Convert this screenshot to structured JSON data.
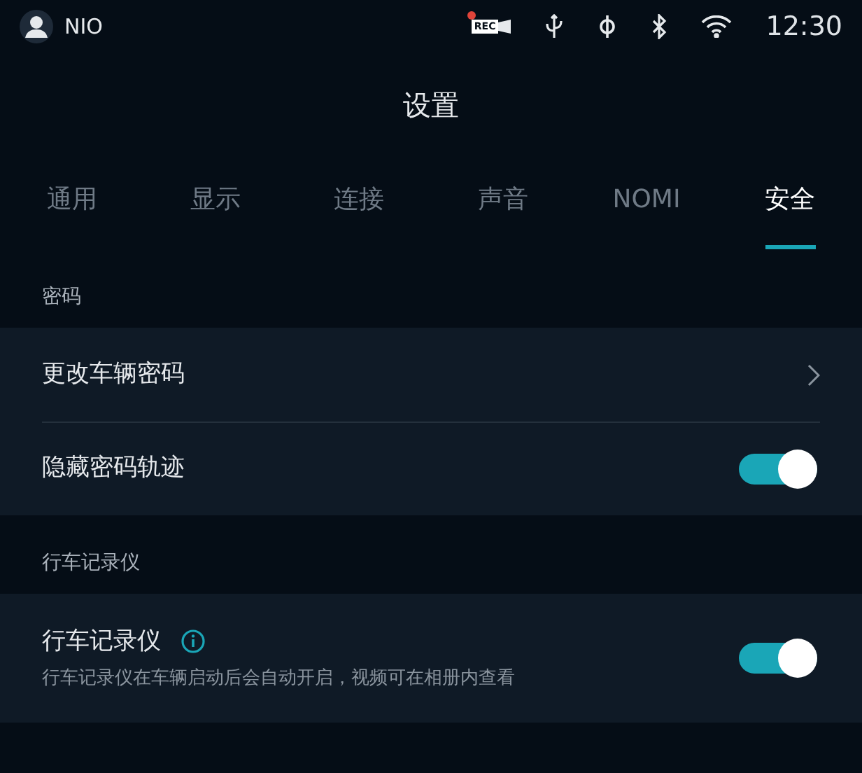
{
  "status_bar": {
    "user": "NIO",
    "rec_label": "REC",
    "time": "12:30"
  },
  "title": "设置",
  "tabs": [
    {
      "label": "通用",
      "selected": false
    },
    {
      "label": "显示",
      "selected": false
    },
    {
      "label": "连接",
      "selected": false
    },
    {
      "label": "声音",
      "selected": false
    },
    {
      "label": "NOMI",
      "selected": false
    },
    {
      "label": "安全",
      "selected": true
    }
  ],
  "sections": [
    {
      "label": "密码",
      "rows": [
        {
          "kind": "link",
          "label": "更改车辆密码"
        },
        {
          "kind": "toggle",
          "label": "隐藏密码轨迹",
          "on": true
        }
      ]
    },
    {
      "label": "行车记录仪",
      "rows": [
        {
          "kind": "toggle",
          "label": "行车记录仪",
          "info": true,
          "description": "行车记录仪在车辆启动后会自动开启，视频可在相册内查看",
          "on": true
        }
      ]
    }
  ]
}
